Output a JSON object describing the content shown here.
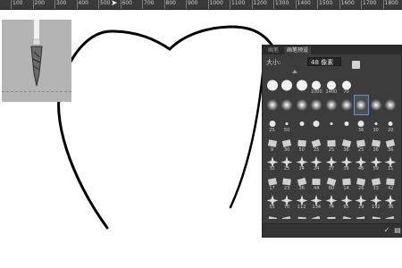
{
  "ruler": {
    "ticks": [
      "100",
      "200",
      "300",
      "400",
      "500",
      "600",
      "700",
      "800",
      "900",
      "1000",
      "1100",
      "1200",
      "1300",
      "1400",
      "1500",
      "1600",
      "1700",
      "1800"
    ]
  },
  "panel": {
    "tabs": [
      "画笔",
      "画笔预设"
    ],
    "size_label": "大小:",
    "size_value": "48 像素",
    "brush_rows": [
      {
        "type": "round-hard",
        "labels": [
          "",
          "",
          "",
          "1000",
          "1400",
          "70"
        ]
      },
      {
        "type": "round-soft",
        "labels": [
          "",
          "",
          "",
          "",
          "",
          "",
          "",
          "",
          ""
        ]
      },
      {
        "type": "dot",
        "labels": [
          "25",
          "50",
          "",
          "",
          "",
          "",
          "36",
          "30",
          "20"
        ]
      },
      {
        "type": "mixed",
        "labels": [
          "9",
          "30",
          "50",
          "25",
          "25",
          "36",
          "25",
          "36",
          "36"
        ]
      },
      {
        "type": "star",
        "labels": [
          "32",
          "25",
          "14",
          "24",
          "27",
          "39",
          "46",
          "59",
          "11"
        ]
      },
      {
        "type": "texture",
        "labels": [
          "17",
          "23",
          "36",
          "44",
          "60",
          "14",
          "26",
          "33",
          "42"
        ]
      },
      {
        "type": "leaf",
        "labels": [
          "55",
          "70",
          "112",
          "134",
          "74",
          "95",
          "29",
          "192",
          "36"
        ]
      },
      {
        "type": "scatter",
        "labels": [
          "48",
          "32",
          "55",
          "100",
          "1869",
          "1427",
          "2112",
          "1804",
          "1264"
        ]
      }
    ],
    "bottom_buttons": [
      "✓",
      "▤"
    ]
  },
  "colors": {
    "ruler_bg": "#3a3a3a",
    "panel_bg": "#3c3c3c",
    "canvas_bg": "#ffffff",
    "preview_bg": "#b4b4b4",
    "stroke": "#000000"
  }
}
